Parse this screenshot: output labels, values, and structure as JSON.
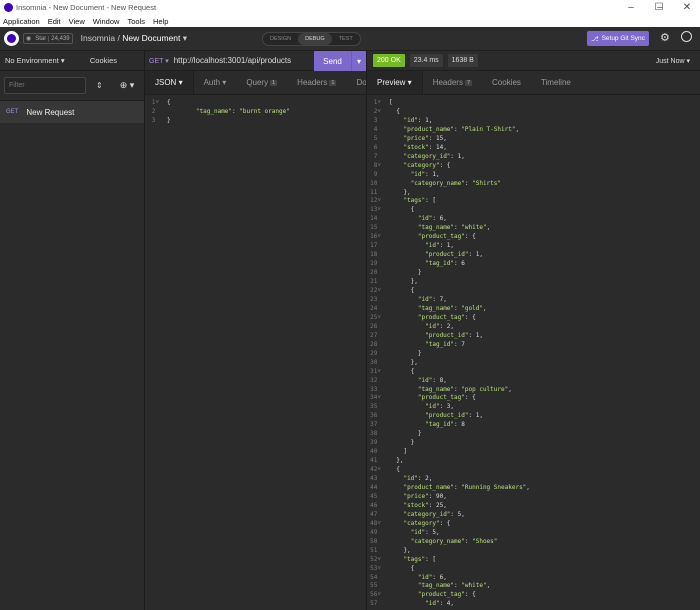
{
  "window": {
    "title": "Insomnia - New Document - New Request",
    "minimize_icon": "minimize-icon",
    "maximize_icon": "maximize-icon",
    "close_icon": "close-icon"
  },
  "menu": [
    "Application",
    "Edit",
    "View",
    "Window",
    "Tools",
    "Help"
  ],
  "toolbar": {
    "star_label": "Star",
    "star_count": "24,439",
    "workspace": "Insomnia",
    "separator": "/",
    "document": "New Document",
    "modes": [
      "DESIGN",
      "DEBUG",
      "TEST"
    ],
    "active_mode": "DEBUG",
    "git_sync": "Setup Git Sync"
  },
  "sidebar": {
    "environment": "No Environment",
    "cookies": "Cookies",
    "filter_placeholder": "Filter",
    "request": {
      "method": "GET",
      "name": "New Request"
    }
  },
  "request": {
    "method": "GET",
    "url": "http://localhost:3001/api/products",
    "send_label": "Send",
    "tabs": [
      {
        "label": "JSON",
        "badge": ""
      },
      {
        "label": "Auth",
        "badge": ""
      },
      {
        "label": "Query",
        "badge": "1"
      },
      {
        "label": "Headers",
        "badge": "1"
      },
      {
        "label": "Docs",
        "badge": ""
      }
    ],
    "body_lines": [
      "{",
      "\t\"tag_name\": \"burnt orange\"",
      "}"
    ]
  },
  "response": {
    "status": "200 OK",
    "time": "23.4 ms",
    "size": "1638 B",
    "history": "Just Now",
    "tabs": [
      {
        "label": "Preview",
        "badge": ""
      },
      {
        "label": "Headers",
        "badge": "7"
      },
      {
        "label": "Cookies",
        "badge": ""
      },
      {
        "label": "Timeline",
        "badge": ""
      }
    ],
    "lines": [
      "[",
      "  {",
      "    \"id\": 1,",
      "    \"product_name\": \"Plain T-Shirt\",",
      "    \"price\": 15,",
      "    \"stock\": 14,",
      "    \"category_id\": 1,",
      "    \"category\": {",
      "      \"id\": 1,",
      "      \"category_name\": \"Shirts\"",
      "    },",
      "    \"tags\": [",
      "      {",
      "        \"id\": 6,",
      "        \"tag_name\": \"white\",",
      "        \"product_tag\": {",
      "          \"id\": 1,",
      "          \"product_id\": 1,",
      "          \"tag_id\": 6",
      "        }",
      "      },",
      "      {",
      "        \"id\": 7,",
      "        \"tag_name\": \"gold\",",
      "        \"product_tag\": {",
      "          \"id\": 2,",
      "          \"product_id\": 1,",
      "          \"tag_id\": 7",
      "        }",
      "      },",
      "      {",
      "        \"id\": 8,",
      "        \"tag_name\": \"pop culture\",",
      "        \"product_tag\": {",
      "          \"id\": 3,",
      "          \"product_id\": 1,",
      "          \"tag_id\": 8",
      "        }",
      "      }",
      "    ]",
      "  },",
      "  {",
      "    \"id\": 2,",
      "    \"product_name\": \"Running Sneakers\",",
      "    \"price\": 90,",
      "    \"stock\": 25,",
      "    \"category_id\": 5,",
      "    \"category\": {",
      "      \"id\": 5,",
      "      \"category_name\": \"Shoes\"",
      "    },",
      "    \"tags\": [",
      "      {",
      "        \"id\": 6,",
      "        \"tag_name\": \"white\",",
      "        \"product_tag\": {",
      "          \"id\": 4,"
    ]
  },
  "colors": {
    "accent": "#7d69cb",
    "status_ok": "#75ba24",
    "string": "#b9e07f",
    "method": "#aa8dd8"
  }
}
